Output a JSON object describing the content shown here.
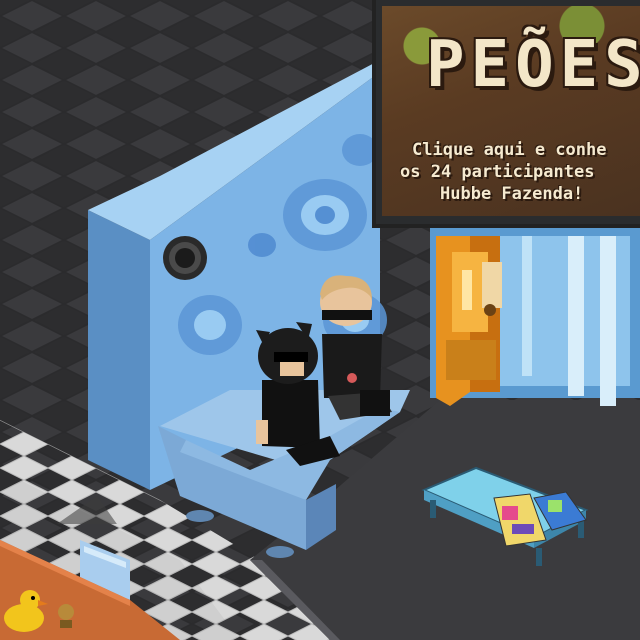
{
  "scene": {
    "type": "isometric-game-room",
    "colors": {
      "floor_dark": "#2e2e30",
      "wall_blue": "#7fb6e6",
      "tile_gray": "#cfcfcf",
      "carpet": "#3a3a3c"
    }
  },
  "banner": {
    "title": "PEÕES",
    "line1": "Clique aqui e conhe",
    "line2": "os 24 participantes",
    "line3": "Hubbe Fazenda!"
  },
  "icons": {
    "duck": "rubber-duck-icon",
    "speaker": "speaker-icon"
  }
}
